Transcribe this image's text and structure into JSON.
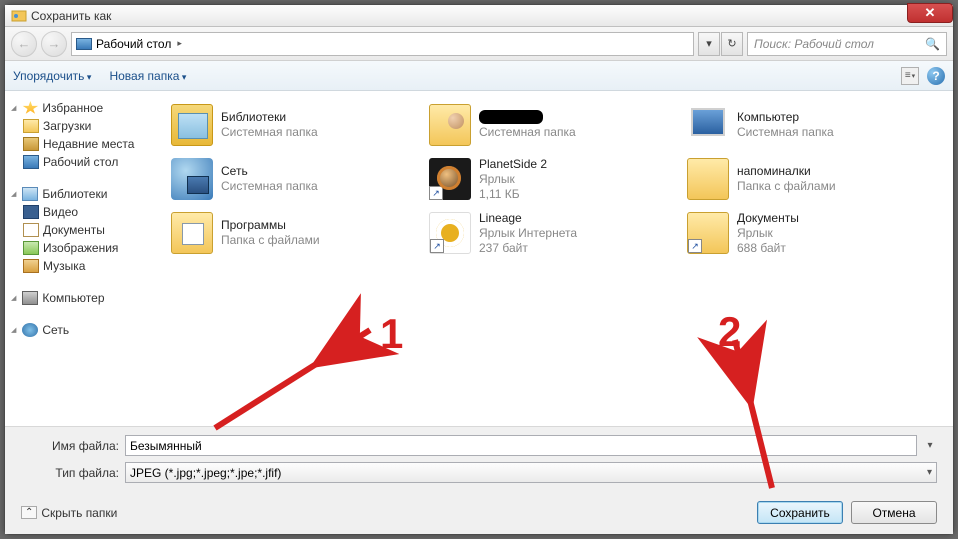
{
  "window": {
    "title": "Сохранить как"
  },
  "nav": {
    "location_icon": "desktop-icon",
    "location": "Рабочий стол",
    "arrow": "▸",
    "refresh": "↻",
    "dropdown": "▾"
  },
  "search": {
    "placeholder": "Поиск: Рабочий стол",
    "icon": "🔍"
  },
  "toolbar": {
    "organize": "Упорядочить",
    "new_folder": "Новая папка",
    "view": "≡",
    "help": "?"
  },
  "sidebar": {
    "favorites": {
      "label": "Избранное",
      "items": [
        {
          "icon": "downloads",
          "label": "Загрузки"
        },
        {
          "icon": "recent",
          "label": "Недавние места"
        },
        {
          "icon": "desktop",
          "label": "Рабочий стол"
        }
      ]
    },
    "libraries": {
      "label": "Библиотеки",
      "items": [
        {
          "icon": "video",
          "label": "Видео"
        },
        {
          "icon": "doc",
          "label": "Документы"
        },
        {
          "icon": "img",
          "label": "Изображения"
        },
        {
          "icon": "music",
          "label": "Музыка"
        }
      ]
    },
    "computer": {
      "label": "Компьютер"
    },
    "network": {
      "label": "Сеть"
    }
  },
  "items": [
    {
      "name": "Библиотеки",
      "sub": "Системная папка",
      "icon": "lib"
    },
    {
      "name": "████████",
      "sub": "Системная папка",
      "icon": "user",
      "redacted": true
    },
    {
      "name": "Компьютер",
      "sub": "Системная папка",
      "icon": "comp"
    },
    {
      "name": "Сеть",
      "sub": "Системная папка",
      "icon": "net"
    },
    {
      "name": "PlanetSide 2",
      "sub": "Ярлык",
      "sub2": "1,11 КБ",
      "icon": "ps2",
      "shortcut": true
    },
    {
      "name": "напоминалки",
      "sub": "Папка с файлами",
      "icon": "folder"
    },
    {
      "name": "Программы",
      "sub": "Папка с файлами",
      "icon": "prog"
    },
    {
      "name": "Lineage",
      "sub": "Ярлык Интернета",
      "sub2": "237 байт",
      "icon": "chrome",
      "shortcut": true
    },
    {
      "name": "Документы",
      "sub": "Ярлык",
      "sub2": "688 байт",
      "icon": "folder",
      "shortcut": true
    }
  ],
  "fields": {
    "filename_label": "Имя файла:",
    "filename_value": "Безымянный",
    "filetype_label": "Тип файла:",
    "filetype_value": "JPEG (*.jpg;*.jpeg;*.jpe;*.jfif)"
  },
  "footer": {
    "hide_folders": "Скрыть папки",
    "save": "Сохранить",
    "cancel": "Отмена"
  },
  "annotations": {
    "one": "1",
    "two": "2"
  }
}
